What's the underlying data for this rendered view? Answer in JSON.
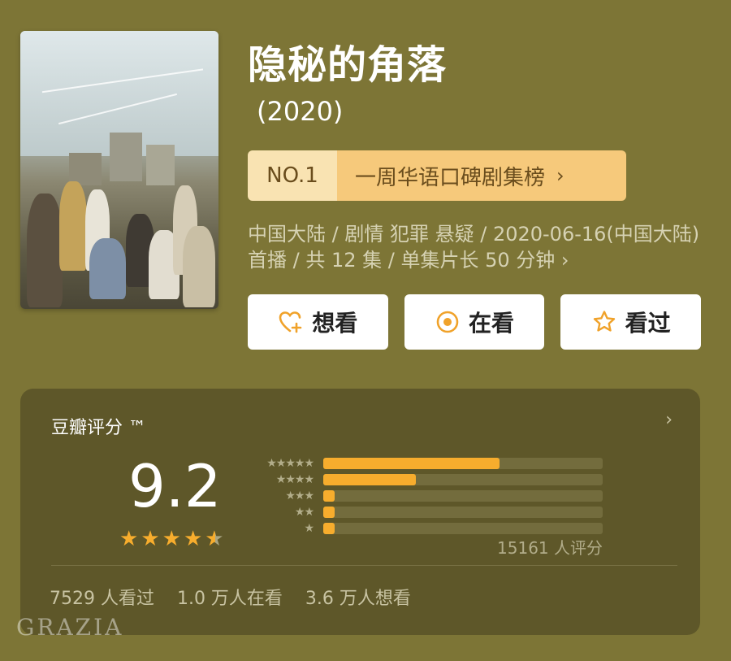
{
  "show": {
    "title": "隐秘的角落",
    "year": "(2020)"
  },
  "ranking": {
    "rank": "NO.1",
    "list_name": "一周华语口碑剧集榜",
    "chevron": "›"
  },
  "meta": {
    "line": "中国大陆 / 剧情 犯罪 悬疑 / 2020-06-16(中国大陆) 首播 / 共 12 集 / 单集片长 50 分钟 ›"
  },
  "actions": {
    "want": "想看",
    "watching": "在看",
    "watched": "看过"
  },
  "rating": {
    "label": "豆瓣评分 ™",
    "chevron": "›",
    "score": "9.2",
    "stars_value": 4.5,
    "distribution": [
      {
        "stars": "★★★★★",
        "fraction": 0.63
      },
      {
        "stars": "★★★★",
        "fraction": 0.33
      },
      {
        "stars": "★★★",
        "fraction": 0.04
      },
      {
        "stars": "★★",
        "fraction": 0.04
      },
      {
        "stars": "★",
        "fraction": 0.04
      }
    ],
    "count": "15161 人评分",
    "stats": "7529 人看过    1.0 万人在看    3.6 万人想看"
  },
  "watermark": "GRAZIA",
  "colors": {
    "background": "#7d7536",
    "card": "#5e5729",
    "accent": "#f7ad2d",
    "rank_tag": "#f6c97b"
  },
  "icons": {
    "want": "heart-plus-icon",
    "watching": "target-circle-icon",
    "watched": "star-outline-icon"
  }
}
